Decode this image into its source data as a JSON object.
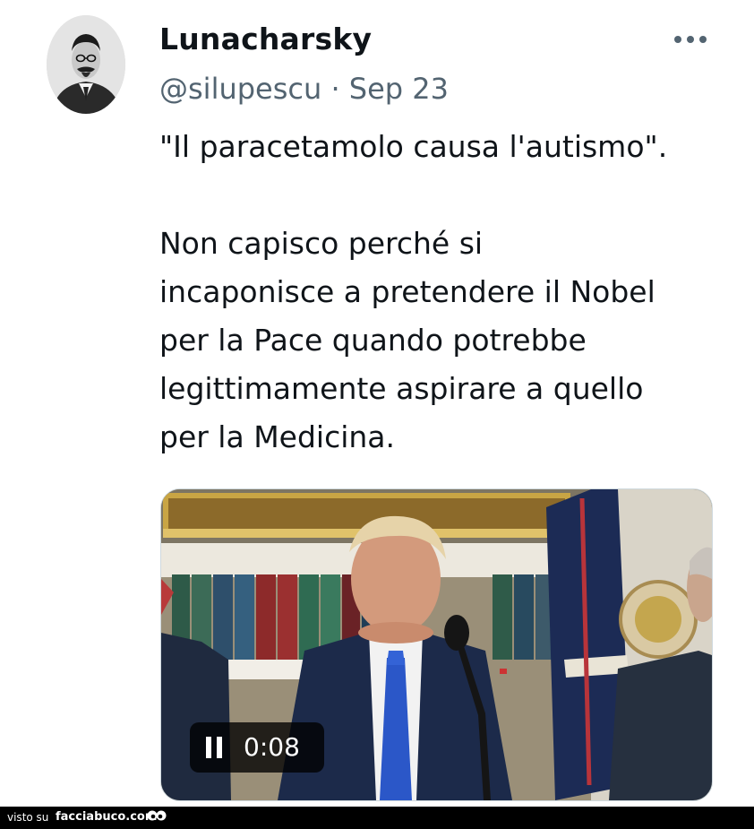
{
  "tweet": {
    "display_name": "Lunacharsky",
    "handle": "@silupescu",
    "separator": "·",
    "date": "Sep 23",
    "text": "\"Il paracetamolo causa l'autismo\".\n\nNon capisco perché si\nincaponisce a pretendere il Nobel\nper la Pace quando potrebbe\nlegittimamente aspirare a quello\nper la Medicina.",
    "more_icon": "more-horizontal-icon"
  },
  "video": {
    "time": "0:08",
    "state_icon": "pause-icon"
  },
  "footer": {
    "prefix": "visto su",
    "brand": "facciabuco.com"
  },
  "colors": {
    "text": "#0f1419",
    "secondary": "#536471",
    "footer_bg": "#000000"
  }
}
